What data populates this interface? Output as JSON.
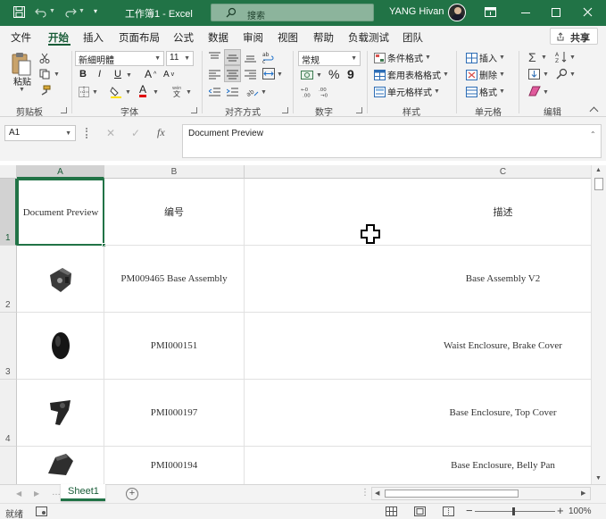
{
  "titlebar": {
    "title": "工作簿1  -  Excel",
    "search_placeholder": "搜索",
    "user_name": "YANG Hivan"
  },
  "menu": {
    "tabs": [
      "文件",
      "开始",
      "插入",
      "页面布局",
      "公式",
      "数据",
      "审阅",
      "视图",
      "帮助",
      "负载测试",
      "团队"
    ],
    "active_tab": "开始",
    "share_label": "共享"
  },
  "ribbon": {
    "clipboard": {
      "paste_label": "粘贴",
      "group_label": "剪贴板"
    },
    "font": {
      "font_name": "新細明體",
      "font_size": "11",
      "bold": "B",
      "italic": "I",
      "underline": "U",
      "grow": "A",
      "shrink": "A",
      "group_label": "字体"
    },
    "alignment": {
      "group_label": "对齐方式"
    },
    "number": {
      "format": "常规",
      "percent": "%",
      "comma": "9",
      "group_label": "数字"
    },
    "styles": {
      "conditional": "条件格式",
      "table": "套用表格格式",
      "cell": "单元格样式",
      "group_label": "样式"
    },
    "cells": {
      "insert": "插入",
      "delete": "删除",
      "format": "格式",
      "group_label": "单元格"
    },
    "editing": {
      "group_label": "编辑"
    }
  },
  "formula_bar": {
    "name_box": "A1",
    "fx": "fx",
    "content": "Document Preview"
  },
  "grid": {
    "columns": [
      "A",
      "B",
      "C"
    ],
    "rows": [
      {
        "num": "1",
        "a": "Document Preview",
        "b": "编号",
        "c": "描述"
      },
      {
        "num": "2",
        "a": "",
        "b": "PM009465 Base Assembly",
        "c": "Base Assembly V2"
      },
      {
        "num": "3",
        "a": "",
        "b": "PMI000151",
        "c": "Waist Enclosure, Brake Cover"
      },
      {
        "num": "4",
        "a": "",
        "b": "PMI000197",
        "c": "Base Enclosure, Top Cover"
      },
      {
        "num": "",
        "a": "",
        "b": "PMI000194",
        "c": "Base Enclosure, Belly Pan"
      }
    ]
  },
  "sheets": {
    "tabs": [
      "Sheet1"
    ]
  },
  "status": {
    "ready": "就绪",
    "zoom": "100%"
  },
  "colors": {
    "brand": "#217346",
    "accent": "#185c37"
  }
}
